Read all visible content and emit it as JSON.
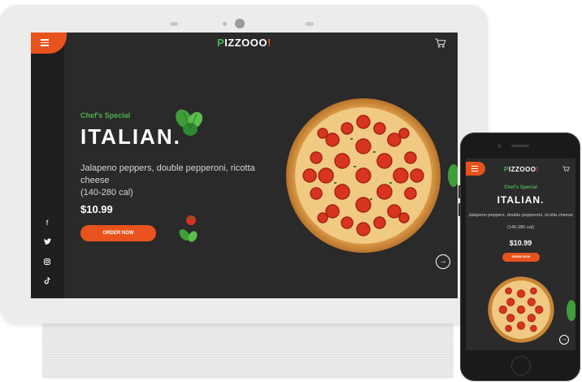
{
  "brand": {
    "logo_first": "P",
    "logo_middle": "IZZOOO",
    "logo_bang": "!",
    "accent_color": "#e8531d",
    "green_color": "#4caf50"
  },
  "hero": {
    "tagline": "Chef's Special",
    "dish_name": "ITALIAN.",
    "description": "Jalapeno peppers, double pepperoni, ricotta cheese",
    "calories": "(140-280 cal)",
    "price": "$10.99",
    "order_label": "ORDER NOW"
  },
  "icons": {
    "menu": "hamburger-menu-icon",
    "cart": "cart-icon",
    "next": "arrow-right-icon",
    "social": [
      "facebook-icon",
      "twitter-icon",
      "instagram-icon",
      "tiktok-icon"
    ]
  }
}
